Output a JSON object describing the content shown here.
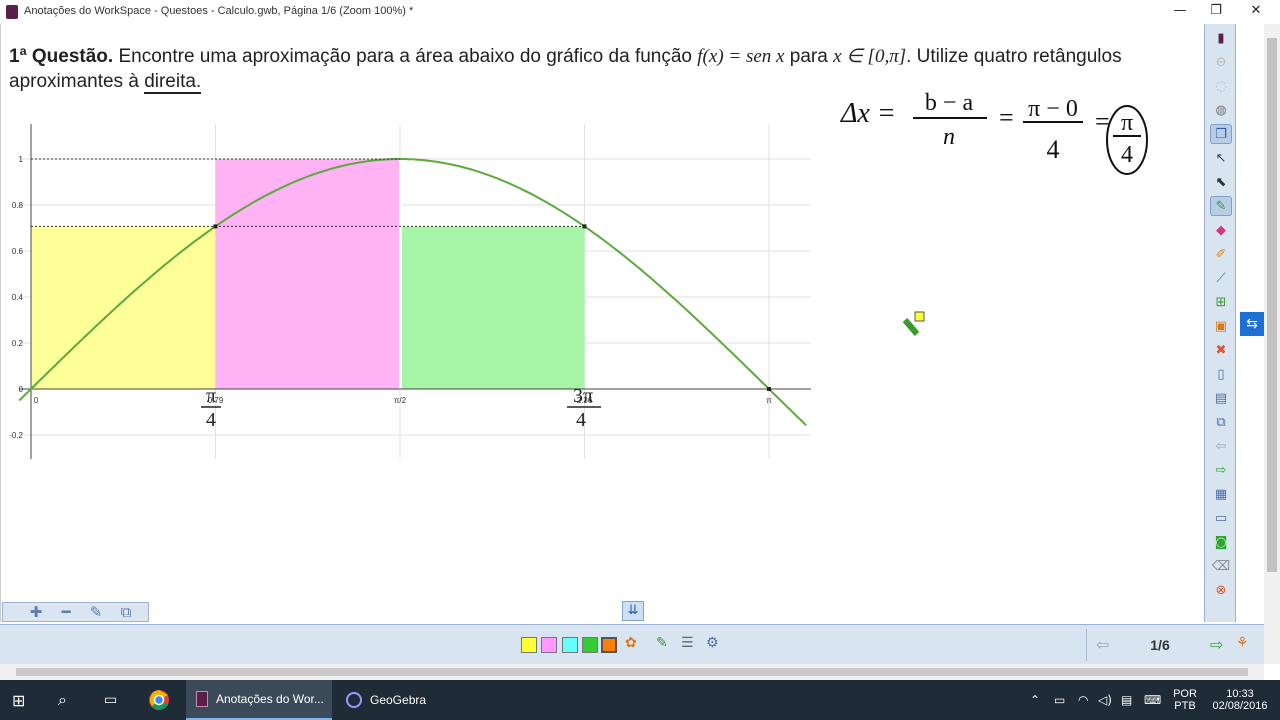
{
  "window": {
    "title": "Anotações do WorkSpace - Questoes - Calculo.gwb, Página 1/6  (Zoom 100%) *",
    "controls": {
      "minimize": "—",
      "restore": "❐",
      "close": "✕"
    }
  },
  "question": {
    "bold_lead": "1ª Questão.",
    "text1": " Encontre uma aproximação para a área abaixo do gráfico da função ",
    "fx": "f(x) = sen x",
    "text2": " para ",
    "domain": "x ∈ [0,π]",
    "text3": ". Utilize quatro retângulos aproximantes à ",
    "underlined": "direita.",
    "text4": ""
  },
  "graph": {
    "y_ticks": [
      "1",
      "0.8",
      "0.6",
      "0.4",
      "0.2",
      "0",
      "-0.2"
    ],
    "x_ticks": [
      "0",
      "0.79",
      "π/2",
      "2.36",
      "π"
    ],
    "handwritten_labels": {
      "pi_over_4_num": "π",
      "pi_over_4_den": "4",
      "three_pi_over_4_num": "3π",
      "three_pi_over_4_den": "4"
    },
    "colors": {
      "yellow": "#ffff99",
      "pink": "#ffb3f5",
      "green": "#a6f5a6",
      "curve": "#5aaa3c"
    }
  },
  "chart_data": {
    "type": "area",
    "function": "sin(x)",
    "xlim": [
      -0.05,
      3.3
    ],
    "ylim": [
      -0.25,
      1.05
    ],
    "x_ticks": [
      "0",
      "0.79",
      "π/2",
      "2.36",
      "π"
    ],
    "y_ticks": [
      "-0.2",
      "0",
      "0.2",
      "0.4",
      "0.6",
      "0.8",
      "1"
    ],
    "rectangles": [
      {
        "x_start": 0,
        "x_end": 0.785,
        "height": 0.707,
        "color": "#ffff99"
      },
      {
        "x_start": 0.785,
        "x_end": 1.571,
        "height": 1.0,
        "color": "#ffb3f5"
      },
      {
        "x_start": 1.571,
        "x_end": 2.356,
        "height": 0.707,
        "color": "#a6f5a6"
      }
    ],
    "points": [
      {
        "x": 0.785,
        "y": 0.707
      },
      {
        "x": 2.356,
        "y": 0.707
      },
      {
        "x": 3.1416,
        "y": 0
      }
    ],
    "grid": true
  },
  "handwritten": {
    "delta": "Δx =",
    "frac1_num": "b − a",
    "frac1_den": "n",
    "eq": "=",
    "frac2_num": "π − 0",
    "frac2_den": "4",
    "frac3_num": "π",
    "frac3_den": "4"
  },
  "toolbar": {
    "items": [
      "binder",
      "gray-circle",
      "gray-circle",
      "mouse",
      "copy",
      "pointer",
      "select",
      "pen",
      "eraser",
      "highlighter",
      "ruler",
      "insert-page",
      "image",
      "delete",
      "new-page",
      "document",
      "copy-page",
      "prev",
      "next",
      "table",
      "save",
      "camera",
      "eraser-tool",
      "close"
    ]
  },
  "bottom": {
    "colors": [
      "#ffff33",
      "#ff99ff",
      "#66ffff",
      "#33cc33",
      "#ff7f00"
    ],
    "page": "1/6"
  },
  "taskbar": {
    "task1": "Anotações do Wor...",
    "task2": "GeoGebra",
    "lang1": "POR",
    "lang2": "PTB",
    "time": "10:33",
    "date": "02/08/2016"
  }
}
